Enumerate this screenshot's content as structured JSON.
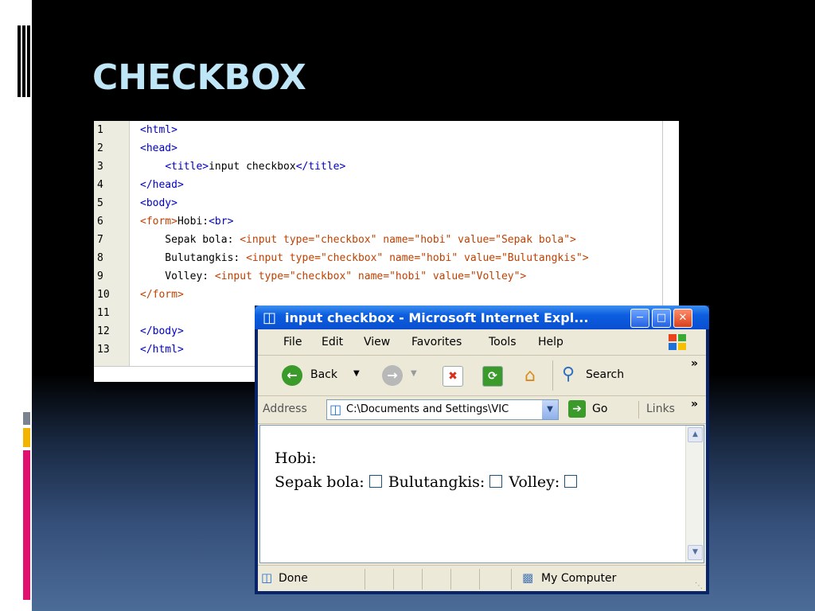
{
  "slide": {
    "title": "CHECKBOX"
  },
  "code": {
    "line_numbers": [
      "1",
      "2",
      "3",
      "4",
      "5",
      "6",
      "7",
      "8",
      "9",
      "10",
      "11",
      "12",
      "13"
    ],
    "lines": [
      "<html>",
      "<head>",
      "    <title>input checkbox</title>",
      "</head>",
      "<body>",
      "<form>Hobi:<br>",
      "    Sepak bola: <input type=\"checkbox\" name=\"hobi\" value=\"Sepak bola\">",
      "    Bulutangkis: <input type=\"checkbox\" name=\"hobi\" value=\"Bulutangkis\">",
      "    Volley: <input type=\"checkbox\" name=\"hobi\" value=\"Volley\">",
      "</form>",
      "",
      "</body>",
      "</html>"
    ]
  },
  "browser": {
    "title": "input checkbox - Microsoft Internet Expl...",
    "menu": [
      "File",
      "Edit",
      "View",
      "Favorites",
      "Tools",
      "Help"
    ],
    "toolbar": {
      "back": "Back",
      "search": "Search",
      "more": "»"
    },
    "address": {
      "label": "Address",
      "value": "C:\\Documents and Settings\\VIC",
      "go": "Go",
      "links": "Links",
      "more": "»"
    },
    "content": {
      "heading": "Hobi:",
      "options": [
        {
          "label": "Sepak bola:",
          "checked": false
        },
        {
          "label": "Bulutangkis:",
          "checked": false
        },
        {
          "label": "Volley:",
          "checked": false
        }
      ]
    },
    "status": {
      "left": "Done",
      "right": "My Computer"
    }
  },
  "colors": {
    "title": "#bfe6f6",
    "titlebar": "#0c5ee0",
    "code_tag": "#0000c0",
    "code_attr": "#c04000"
  }
}
